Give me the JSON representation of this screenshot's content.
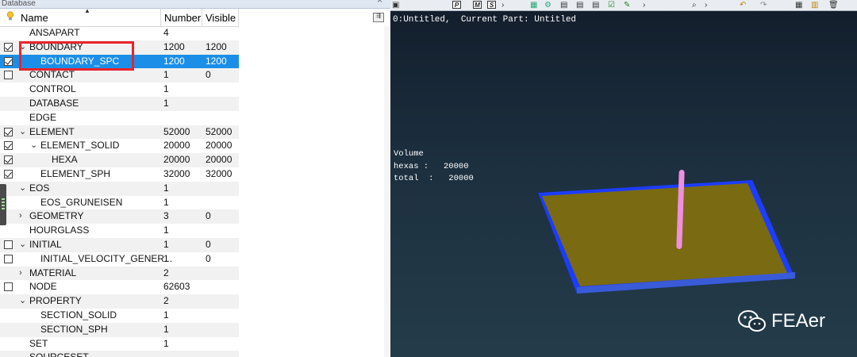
{
  "panel": {
    "title": "Database",
    "columns": {
      "name": "Name",
      "number": "Number",
      "visible": "Visible"
    },
    "rows": [
      {
        "indent": 0,
        "expander": "",
        "checkbox": "none",
        "label": "ANSAPART",
        "number": "4",
        "visible": ""
      },
      {
        "indent": 0,
        "expander": "down",
        "checkbox": "checked",
        "label": "BOUNDARY",
        "number": "1200",
        "visible": "1200"
      },
      {
        "indent": 1,
        "expander": "",
        "checkbox": "checked",
        "label": "BOUNDARY_SPC",
        "number": "1200",
        "visible": "1200",
        "selected": true
      },
      {
        "indent": 0,
        "expander": "",
        "checkbox": "unchecked",
        "label": "CONTACT",
        "number": "1",
        "visible": "0"
      },
      {
        "indent": 0,
        "expander": "",
        "checkbox": "none",
        "label": "CONTROL",
        "number": "1",
        "visible": ""
      },
      {
        "indent": 0,
        "expander": "",
        "checkbox": "none",
        "label": "DATABASE",
        "number": "1",
        "visible": ""
      },
      {
        "indent": 0,
        "expander": "",
        "checkbox": "none",
        "label": "EDGE",
        "number": "",
        "visible": ""
      },
      {
        "indent": 0,
        "expander": "down",
        "checkbox": "checked",
        "label": "ELEMENT",
        "number": "52000",
        "visible": "52000"
      },
      {
        "indent": 1,
        "expander": "down",
        "checkbox": "checked",
        "label": "ELEMENT_SOLID",
        "number": "20000",
        "visible": "20000"
      },
      {
        "indent": 2,
        "expander": "",
        "checkbox": "checked",
        "label": "HEXA",
        "number": "20000",
        "visible": "20000"
      },
      {
        "indent": 1,
        "expander": "",
        "checkbox": "checked",
        "label": "ELEMENT_SPH",
        "number": "32000",
        "visible": "32000"
      },
      {
        "indent": 0,
        "expander": "down",
        "checkbox": "none",
        "label": "EOS",
        "number": "1",
        "visible": ""
      },
      {
        "indent": 1,
        "expander": "",
        "checkbox": "none",
        "label": "EOS_GRUNEISEN",
        "number": "1",
        "visible": ""
      },
      {
        "indent": 0,
        "expander": "right",
        "checkbox": "none",
        "label": "GEOMETRY",
        "number": "3",
        "visible": "0"
      },
      {
        "indent": 0,
        "expander": "",
        "checkbox": "none",
        "label": "HOURGLASS",
        "number": "1",
        "visible": ""
      },
      {
        "indent": 0,
        "expander": "down",
        "checkbox": "unchecked",
        "label": "INITIAL",
        "number": "1",
        "visible": "0"
      },
      {
        "indent": 1,
        "expander": "",
        "checkbox": "unchecked",
        "label": "INITIAL_VELOCITY_GENER...",
        "number": "1",
        "visible": "0"
      },
      {
        "indent": 0,
        "expander": "right",
        "checkbox": "none",
        "label": "MATERIAL",
        "number": "2",
        "visible": ""
      },
      {
        "indent": 0,
        "expander": "",
        "checkbox": "unchecked",
        "label": "NODE",
        "number": "62603",
        "visible": ""
      },
      {
        "indent": 0,
        "expander": "down",
        "checkbox": "none",
        "label": "PROPERTY",
        "number": "2",
        "visible": ""
      },
      {
        "indent": 1,
        "expander": "",
        "checkbox": "none",
        "label": "SECTION_SOLID",
        "number": "1",
        "visible": ""
      },
      {
        "indent": 1,
        "expander": "",
        "checkbox": "none",
        "label": "SECTION_SPH",
        "number": "1",
        "visible": ""
      },
      {
        "indent": 0,
        "expander": "",
        "checkbox": "none",
        "label": "SET",
        "number": "1",
        "visible": ""
      },
      {
        "indent": 0,
        "expander": "",
        "checkbox": "none",
        "label": "SOURCESET",
        "number": "",
        "visible": ""
      }
    ]
  },
  "viewport": {
    "title": "0:Untitled,  Current Part: Untitled",
    "info_title": "Volume",
    "info_hexas": "hexas :   20000",
    "info_total": "total  :   20000",
    "toolbar_boxes": [
      "P",
      "M",
      "S"
    ],
    "colors": {
      "plate_fill": "#7a6a12",
      "plate_edge": "#1c3cff",
      "rod": "#f08ee0"
    }
  },
  "watermark": {
    "text": "FEAer"
  }
}
